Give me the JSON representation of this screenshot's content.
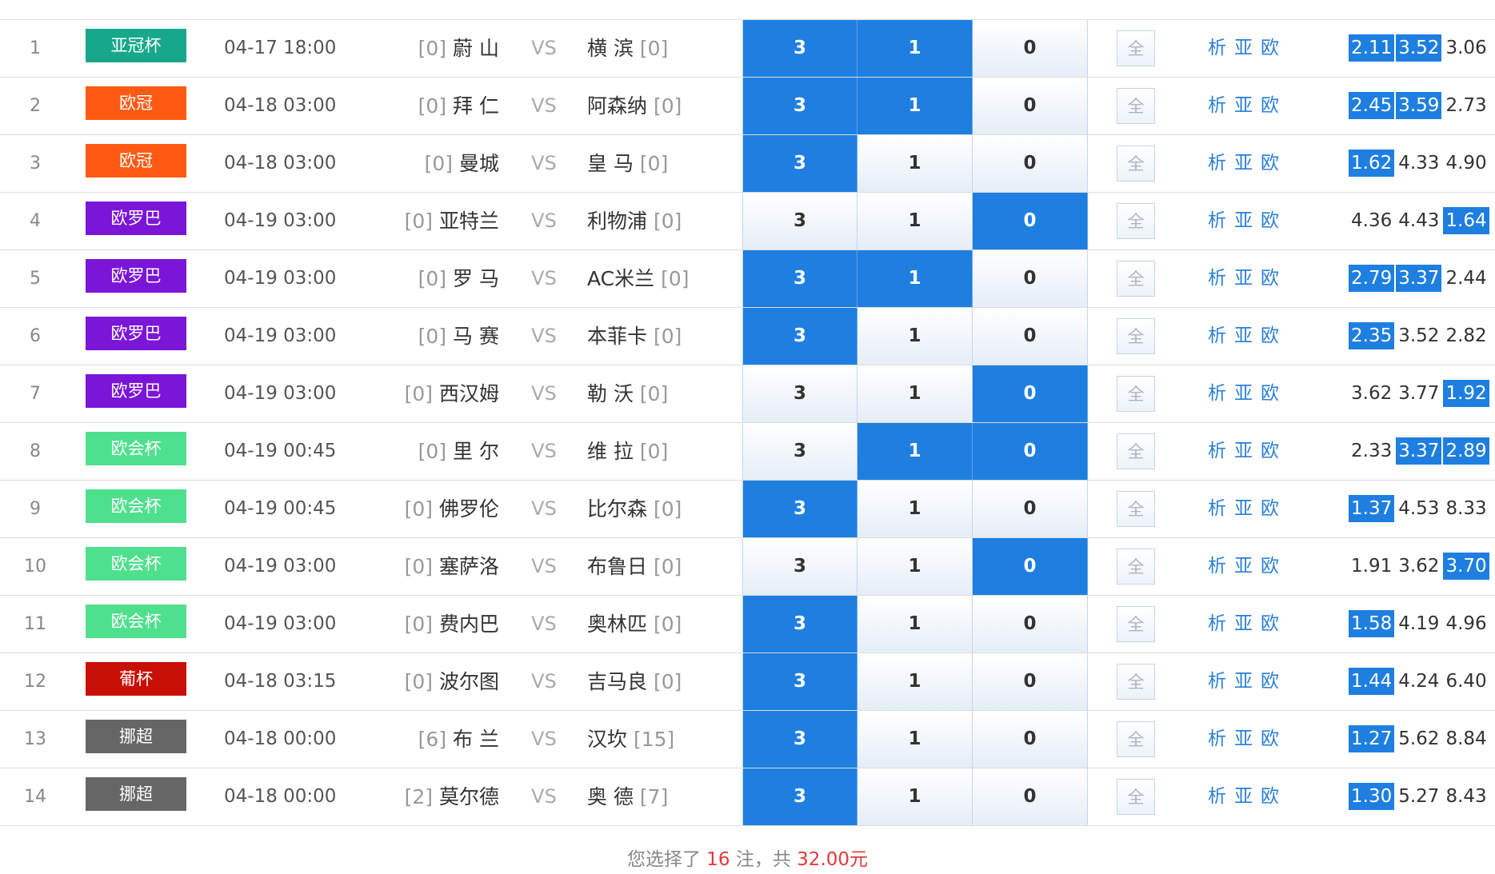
{
  "colors": {
    "selected": "#1e7fe0",
    "link": "#2a7fd6",
    "summary_red": "#e03a3a"
  },
  "vs_label": "VS",
  "all_label": "全",
  "link_labels": [
    "析",
    "亚",
    "欧"
  ],
  "options": [
    "3",
    "1",
    "0"
  ],
  "matches": [
    {
      "num": "1",
      "league": "亚冠杯",
      "league_color": "#17a88b",
      "time": "04-17 18:00",
      "home_rank": "[0]",
      "home": "蔚 山",
      "away": "横 滨",
      "away_rank": "[0]",
      "selected": [
        true,
        true,
        false
      ],
      "odds": [
        "2.11",
        "3.52",
        "3.06"
      ],
      "odds_hl": [
        true,
        true,
        false
      ]
    },
    {
      "num": "2",
      "league": "欧冠",
      "league_color": "#ff5a14",
      "time": "04-18 03:00",
      "home_rank": "[0]",
      "home": "拜 仁",
      "away": "阿森纳",
      "away_rank": "[0]",
      "selected": [
        true,
        true,
        false
      ],
      "odds": [
        "2.45",
        "3.59",
        "2.73"
      ],
      "odds_hl": [
        true,
        true,
        false
      ]
    },
    {
      "num": "3",
      "league": "欧冠",
      "league_color": "#ff5a14",
      "time": "04-18 03:00",
      "home_rank": "[0]",
      "home": "曼城",
      "away": "皇 马",
      "away_rank": "[0]",
      "selected": [
        true,
        false,
        false
      ],
      "odds": [
        "1.62",
        "4.33",
        "4.90"
      ],
      "odds_hl": [
        true,
        false,
        false
      ]
    },
    {
      "num": "4",
      "league": "欧罗巴",
      "league_color": "#7b16d9",
      "time": "04-19 03:00",
      "home_rank": "[0]",
      "home": "亚特兰",
      "away": "利物浦",
      "away_rank": "[0]",
      "selected": [
        false,
        false,
        true
      ],
      "odds": [
        "4.36",
        "4.43",
        "1.64"
      ],
      "odds_hl": [
        false,
        false,
        true
      ]
    },
    {
      "num": "5",
      "league": "欧罗巴",
      "league_color": "#7b16d9",
      "time": "04-19 03:00",
      "home_rank": "[0]",
      "home": "罗 马",
      "away": "AC米兰",
      "away_rank": "[0]",
      "selected": [
        true,
        true,
        false
      ],
      "odds": [
        "2.79",
        "3.37",
        "2.44"
      ],
      "odds_hl": [
        true,
        true,
        false
      ]
    },
    {
      "num": "6",
      "league": "欧罗巴",
      "league_color": "#7b16d9",
      "time": "04-19 03:00",
      "home_rank": "[0]",
      "home": "马 赛",
      "away": "本菲卡",
      "away_rank": "[0]",
      "selected": [
        true,
        false,
        false
      ],
      "odds": [
        "2.35",
        "3.52",
        "2.82"
      ],
      "odds_hl": [
        true,
        false,
        false
      ]
    },
    {
      "num": "7",
      "league": "欧罗巴",
      "league_color": "#7b16d9",
      "time": "04-19 03:00",
      "home_rank": "[0]",
      "home": "西汉姆",
      "away": "勒 沃",
      "away_rank": "[0]",
      "selected": [
        false,
        false,
        true
      ],
      "odds": [
        "3.62",
        "3.77",
        "1.92"
      ],
      "odds_hl": [
        false,
        false,
        true
      ]
    },
    {
      "num": "8",
      "league": "欧会杯",
      "league_color": "#4fe08e",
      "time": "04-19 00:45",
      "home_rank": "[0]",
      "home": "里 尔",
      "away": "维 拉",
      "away_rank": "[0]",
      "selected": [
        false,
        true,
        true
      ],
      "odds": [
        "2.33",
        "3.37",
        "2.89"
      ],
      "odds_hl": [
        false,
        true,
        true
      ]
    },
    {
      "num": "9",
      "league": "欧会杯",
      "league_color": "#4fe08e",
      "time": "04-19 00:45",
      "home_rank": "[0]",
      "home": "佛罗伦",
      "away": "比尔森",
      "away_rank": "[0]",
      "selected": [
        true,
        false,
        false
      ],
      "odds": [
        "1.37",
        "4.53",
        "8.33"
      ],
      "odds_hl": [
        true,
        false,
        false
      ]
    },
    {
      "num": "10",
      "league": "欧会杯",
      "league_color": "#4fe08e",
      "time": "04-19 03:00",
      "home_rank": "[0]",
      "home": "塞萨洛",
      "away": "布鲁日",
      "away_rank": "[0]",
      "selected": [
        false,
        false,
        true
      ],
      "odds": [
        "1.91",
        "3.62",
        "3.70"
      ],
      "odds_hl": [
        false,
        false,
        true
      ]
    },
    {
      "num": "11",
      "league": "欧会杯",
      "league_color": "#4fe08e",
      "time": "04-19 03:00",
      "home_rank": "[0]",
      "home": "费内巴",
      "away": "奥林匹",
      "away_rank": "[0]",
      "selected": [
        true,
        false,
        false
      ],
      "odds": [
        "1.58",
        "4.19",
        "4.96"
      ],
      "odds_hl": [
        true,
        false,
        false
      ]
    },
    {
      "num": "12",
      "league": "葡杯",
      "league_color": "#c80f06",
      "time": "04-18 03:15",
      "home_rank": "[0]",
      "home": "波尔图",
      "away": "吉马良",
      "away_rank": "[0]",
      "selected": [
        true,
        false,
        false
      ],
      "odds": [
        "1.44",
        "4.24",
        "6.40"
      ],
      "odds_hl": [
        true,
        false,
        false
      ]
    },
    {
      "num": "13",
      "league": "挪超",
      "league_color": "#666666",
      "time": "04-18 00:00",
      "home_rank": "[6]",
      "home": "布 兰",
      "away": "汉坎",
      "away_rank": "[15]",
      "selected": [
        true,
        false,
        false
      ],
      "odds": [
        "1.27",
        "5.62",
        "8.84"
      ],
      "odds_hl": [
        true,
        false,
        false
      ]
    },
    {
      "num": "14",
      "league": "挪超",
      "league_color": "#666666",
      "time": "04-18 00:00",
      "home_rank": "[2]",
      "home": "莫尔德",
      "away": "奥 德",
      "away_rank": "[7]",
      "selected": [
        true,
        false,
        false
      ],
      "odds": [
        "1.30",
        "5.27",
        "8.43"
      ],
      "odds_hl": [
        true,
        false,
        false
      ]
    }
  ],
  "summary": {
    "prefix": "您选择了",
    "bets": "16",
    "middle": "注，共",
    "amount": "32.00元"
  }
}
